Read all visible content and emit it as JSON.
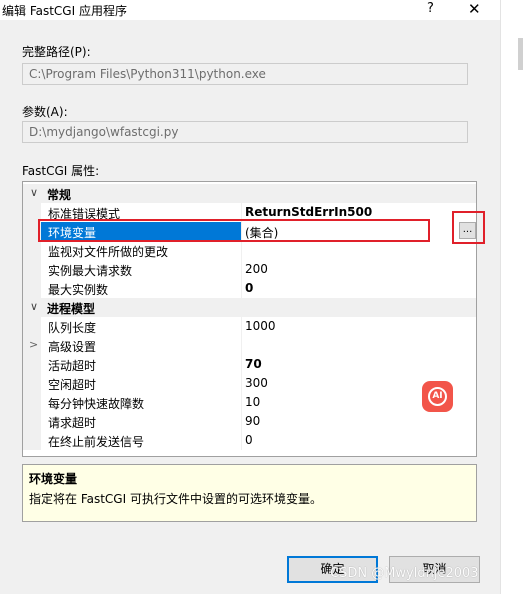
{
  "dialog": {
    "title": "编辑 FastCGI 应用程序",
    "help_glyph": "?",
    "close_glyph": "✕"
  },
  "fields": {
    "full_path_label": "完整路径(P):",
    "full_path_value": "C:\\Program Files\\Python311\\python.exe",
    "args_label": "参数(A):",
    "args_value": "D:\\mydjango\\wfastcgi.py",
    "props_label": "FastCGI 属性:"
  },
  "grid": {
    "category_general": "常规",
    "category_process": "进程模型",
    "expand_glyph": "∨",
    "collapsed_glyph": ">",
    "ellipsis": "...",
    "rows": [
      {
        "name": "标准错误模式",
        "value": "ReturnStdErrIn500"
      },
      {
        "name": "环境变量",
        "value": "(集合)"
      },
      {
        "name": "监视对文件所做的更改",
        "value": ""
      },
      {
        "name": "实例最大请求数",
        "value": "200"
      },
      {
        "name": "最大实例数",
        "value": "0"
      },
      {
        "name": "队列长度",
        "value": "1000"
      },
      {
        "name": "高级设置",
        "value": ""
      },
      {
        "name": "活动超时",
        "value": "70"
      },
      {
        "name": "空闲超时",
        "value": "300"
      },
      {
        "name": "每分钟快速故障数",
        "value": "10"
      },
      {
        "name": "请求超时",
        "value": "90"
      },
      {
        "name": "在终止前发送信号",
        "value": "0"
      }
    ]
  },
  "description": {
    "title": "环境变量",
    "text": "指定将在 FastCGI 可执行文件中设置的可选环境变量。"
  },
  "buttons": {
    "ok": "确定",
    "cancel": "取消"
  },
  "badge": {
    "text": "AI"
  },
  "watermark": "CSDN @Mwyldnje2003",
  "colors": {
    "selection": "#0078d7",
    "highlight_box": "#e0202a",
    "badge": "#f2554a"
  }
}
